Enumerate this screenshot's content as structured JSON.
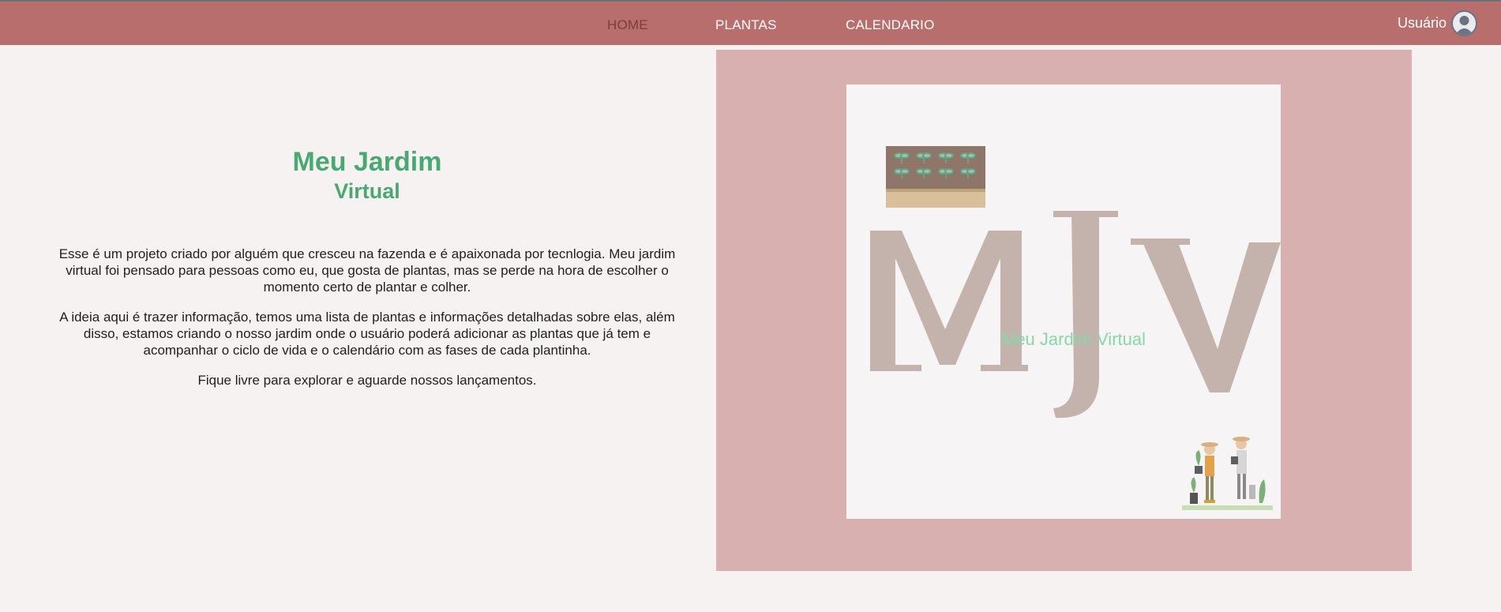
{
  "nav": {
    "items": [
      {
        "label": "HOME",
        "active": true
      },
      {
        "label": "PLANTAS",
        "active": false
      },
      {
        "label": "CALENDARIO",
        "active": false
      }
    ],
    "user_label": "Usuário",
    "user_icon": "user-avatar-icon"
  },
  "intro": {
    "title": "Meu Jardim",
    "subtitle": "Virtual",
    "paragraphs": [
      "Esse é um projeto criado por alguém que cresceu na fazenda e é apaixonada por tecnlogia. Meu jardim virtual foi pensado para pessoas como eu, que gosta de plantas, mas se perde na hora de escolher o momento certo de plantar e colher.",
      "A ideia aqui é trazer informação, temos uma lista de plantas e informações detalhadas sobre elas, além disso, estamos criando o nosso jardim onde o usuário poderá adicionar as plantas que já tem e acompanhar o ciclo de vida e o calendário com as fases de cada plantinha.",
      "Fique livre para explorar e aguarde nossos lançamentos."
    ]
  },
  "logo": {
    "caption": "Meu Jardim Virtual",
    "icons": [
      "planter-box-icon",
      "gardeners-illustration-icon"
    ]
  },
  "colors": {
    "topbar": "#b86e6c",
    "nav_active": "#7a3e3d",
    "title": "#4aa872",
    "hero_frame": "#d9b0b0",
    "logo_caption": "#86d8a9",
    "monogram": "#c4b3ad"
  }
}
